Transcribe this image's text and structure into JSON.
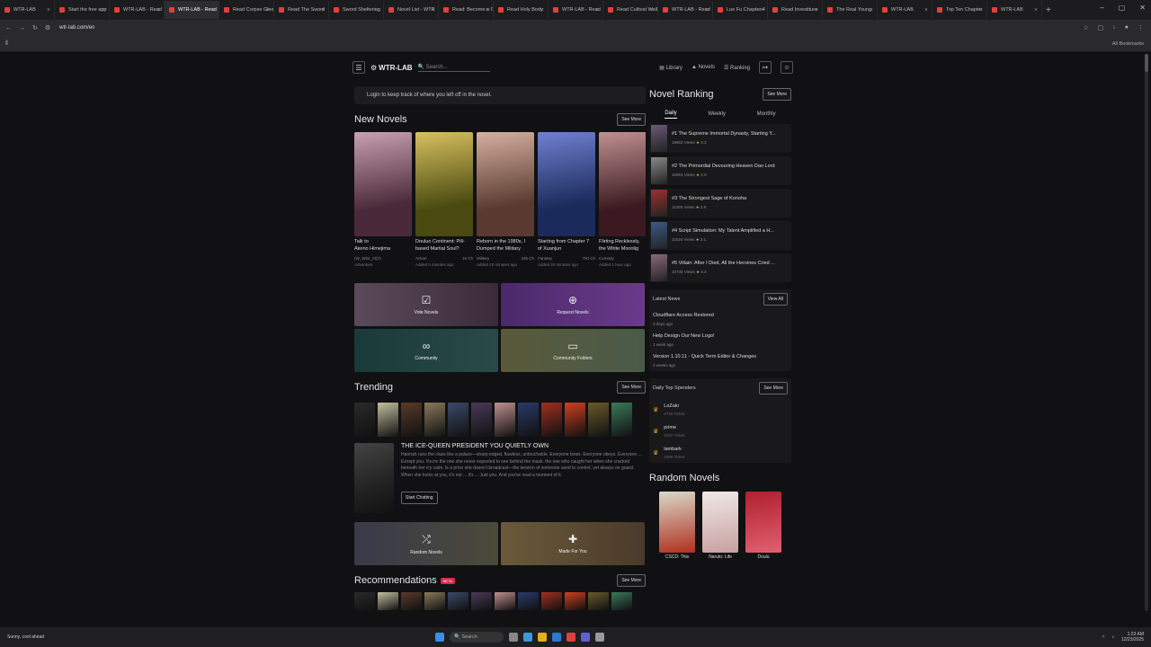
{
  "browser": {
    "tabs": [
      {
        "label": "WTR-LAB"
      },
      {
        "label": "Start the free app"
      },
      {
        "label": "WTR-LAB - Read"
      },
      {
        "label": "WTR-LAB - Read"
      },
      {
        "label": "Read Corpse Glee"
      },
      {
        "label": "Read The Sword"
      },
      {
        "label": "Sword Sheltering"
      },
      {
        "label": "Novel List - WTR"
      },
      {
        "label": "Read: Become a Gl"
      },
      {
        "label": "Read Holy Body"
      },
      {
        "label": "WTR-LAB - Read"
      },
      {
        "label": "Read Cultivat Wall"
      },
      {
        "label": "WTR-LAB - Read"
      },
      {
        "label": "Luo Fu Chapter 4"
      },
      {
        "label": "Read Investiture"
      },
      {
        "label": "The Real Young"
      },
      {
        "label": "WTR-LAB"
      },
      {
        "label": "Top Ten Chapter"
      },
      {
        "label": "WTR-LAB"
      }
    ],
    "active_tab_index": 3,
    "url": "wtr-lab.com/en",
    "all_bookmarks": "All Bookmarks"
  },
  "site": {
    "logo": "WTR-LAB",
    "search_placeholder": "Search...",
    "nav": [
      "Library",
      "Novels",
      "Ranking"
    ]
  },
  "main": {
    "login_note": "Login to keep track of where you left off in the novel.",
    "new_novels": {
      "title": "New Novels",
      "see_more": "See More",
      "cards": [
        {
          "title1": "Talk to",
          "title2": "Akeno Himejima",
          "meta_l": "(W_Wfor_00)'s",
          "meta_r": "",
          "added": "Adventure",
          "c1": "#4a2a3a",
          "c2": "#c9a0b0"
        },
        {
          "title1": "Douluo Continent: Pill-",
          "title2": "based Martial Soul?",
          "meta_l": "Action",
          "meta_r": "16 Ch",
          "added": "Added 5 minutes ago",
          "c1": "#4a4a10",
          "c2": "#d8c060"
        },
        {
          "title1": "Reborn in the 1980s, I",
          "title2": "Dumped the Military",
          "meta_l": "Military",
          "meta_r": "435 Ch",
          "added": "Added 10 minutes ago",
          "c1": "#5a3a30",
          "c2": "#d4b0a0"
        },
        {
          "title1": "Starting from Chapter 7",
          "title2": "of Xuanjun",
          "meta_l": "Fantasy",
          "meta_r": "750 Ch",
          "added": "Added 40 minutes ago",
          "c1": "#1a2a5a",
          "c2": "#7080d0"
        },
        {
          "title1": "Flirting Recklessly,",
          "title2": "the White Moonlig",
          "meta_l": "Comedy",
          "meta_r": "",
          "added": "Added 1 hour ago",
          "c1": "#3a1a20",
          "c2": "#c09090"
        }
      ]
    },
    "tiles": [
      {
        "label": "Vote Novels",
        "icon": "ballot-icon"
      },
      {
        "label": "Request Novels",
        "icon": "plus-circle-icon"
      },
      {
        "label": "Community",
        "icon": "infinity-icon"
      },
      {
        "label": "Community Folders",
        "icon": "folder-icon"
      }
    ],
    "trending": {
      "title": "Trending",
      "see_more": "See More",
      "feature_title": "THE ICE-QUEEN PRESIDENT YOU QUIETLY OWN",
      "feature_desc": "Hannah runs the class like a palace—sharp-edged, flawless, untouchable. Everyone bows. Everyone obeys. Everyone ... Except you. You're the one she never expected to see behind the mask. the one who caught her when she cracked beneath her icy calm. Is a price she doesn't broadcast—the tension of someone used to control, yet always on guard. When she looks at you, it's not ... it's ... Just you. And you've read a moment of it.",
      "chat_button": "Start Chatting"
    },
    "random_tiles": [
      {
        "label": "Random Novels",
        "icon": "shuffle-icon"
      },
      {
        "label": "Made For You",
        "icon": "gift-icon"
      }
    ],
    "recommendations": {
      "title": "Recommendations",
      "badge": "BETA",
      "see_more": "See More"
    }
  },
  "side": {
    "ranking": {
      "title": "Novel Ranking",
      "see_more": "See More",
      "tabs": [
        "Daily",
        "Weekly",
        "Monthly"
      ],
      "items": [
        {
          "title": "#1 The Supreme Immortal Dynasty, Starting Y...",
          "views": "19663 Views",
          "rating": "3.3"
        },
        {
          "title": "#2 The Primordial Devouring Heaven Dao Lord",
          "views": "15554 Views",
          "rating": "2.0"
        },
        {
          "title": "#3 The Strongest Sage of Konoha",
          "views": "11395 Views",
          "rating": "2.8"
        },
        {
          "title": "#4 Script Simulation: My Talent Amplified a H...",
          "views": "11516 Views",
          "rating": "3.1"
        },
        {
          "title": "#5 Villain: After I Died, All the Heroines Cried ...",
          "views": "10735 Views",
          "rating": "3.2"
        }
      ]
    },
    "latest_news": {
      "title": "Latest News",
      "view_all": "View All",
      "items": [
        {
          "title": "Cloudflare Access Restored",
          "date": "3 days ago"
        },
        {
          "title": "Help Design Our New Logo!",
          "date": "1 week ago"
        },
        {
          "title": "Version 1.10.11 - Quick Term Editor & Changes",
          "date": "2 weeks ago"
        }
      ]
    },
    "sponsors": {
      "title": "Daily Top Spenders",
      "see_more": "See More",
      "items": [
        {
          "name": "LoZaki",
          "value": "2745 Ticket"
        },
        {
          "name": "prime",
          "value": "2157 Ticket"
        },
        {
          "name": "lambark",
          "value": "2099 Ticket"
        }
      ]
    },
    "random": {
      "title": "Random Novels",
      "items": [
        {
          "label": "CSCD: This",
          "c1": "#d8d8c8",
          "c2": "#b03020"
        },
        {
          "label": "Naruto: Life",
          "c1": "#f0e8e8",
          "c2": "#c8a0a0"
        },
        {
          "label": "Doulu",
          "c1": "#b02030",
          "c2": "#e06070"
        }
      ]
    }
  },
  "taskbar": {
    "weather": "Sunny, cool ahead",
    "search": "Search",
    "time": "1:23 AM",
    "date": "12/23/2025"
  }
}
